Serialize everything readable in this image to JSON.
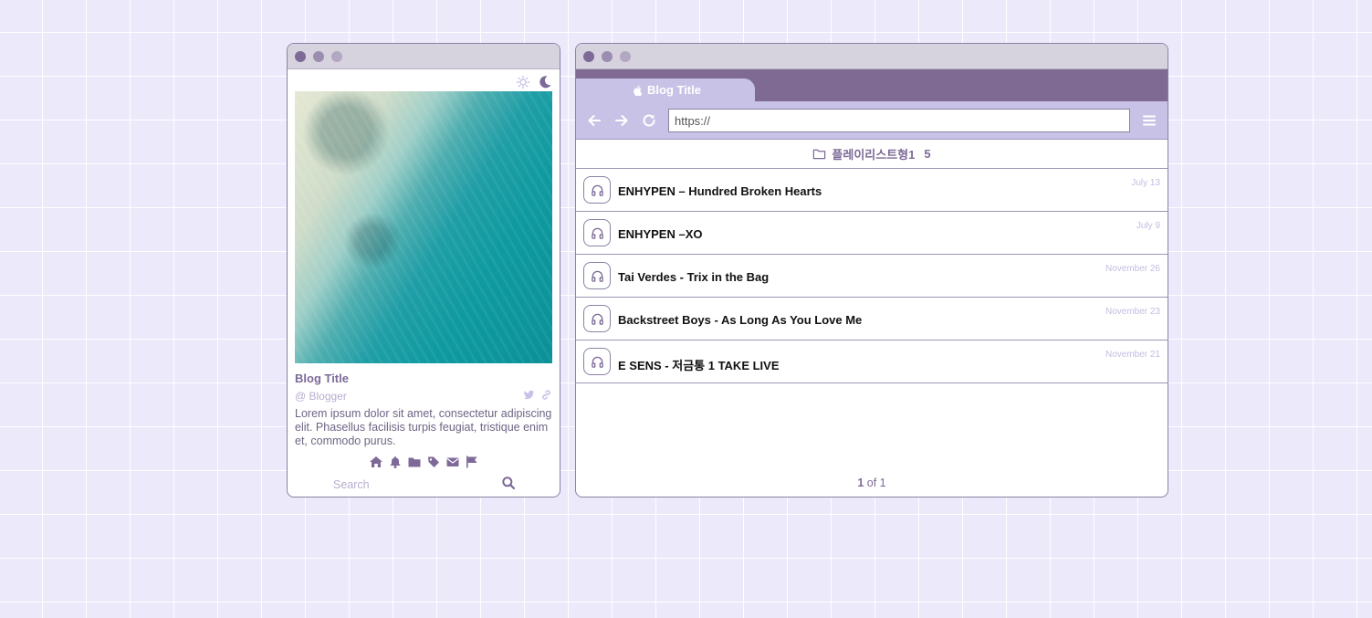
{
  "colors": {
    "accent": "#7d6a98",
    "light_accent": "#c8c3e6",
    "background": "#ece9fb",
    "muted": "#b9aed0"
  },
  "left_panel": {
    "theme_icons": [
      "sun-icon",
      "moon-icon"
    ],
    "blog_title": "Blog Title",
    "blogger": "@ Blogger",
    "social_icons": [
      "twitter-icon",
      "link-icon"
    ],
    "description": "Lorem ipsum dolor sit amet, consectetur adipiscing elit. Phasellus facilisis turpis feugiat, tristique enim et, commodo purus.",
    "nav_icons": [
      "home-icon",
      "bell-icon",
      "folder-icon",
      "tag-icon",
      "mail-icon",
      "flag-icon"
    ],
    "search_placeholder": "Search"
  },
  "browser": {
    "tab_label": "Blog Title",
    "url_value": "https://",
    "folder_name": "플레이리스트형1",
    "folder_count": "5",
    "items": [
      {
        "title": "ENHYPEN – Hundred Broken Hearts",
        "date": "July 13"
      },
      {
        "title": "ENHYPEN –XO",
        "date": "July 9"
      },
      {
        "title": "Tai Verdes - Trix in the Bag",
        "date": "November 26"
      },
      {
        "title": "Backstreet Boys - As Long As You Love Me",
        "date": "November 23"
      },
      {
        "title": "E SENS - 저금통 1 TAKE LIVE",
        "date": "November 21"
      }
    ],
    "page_current": "1",
    "page_suffix": "of 1"
  }
}
